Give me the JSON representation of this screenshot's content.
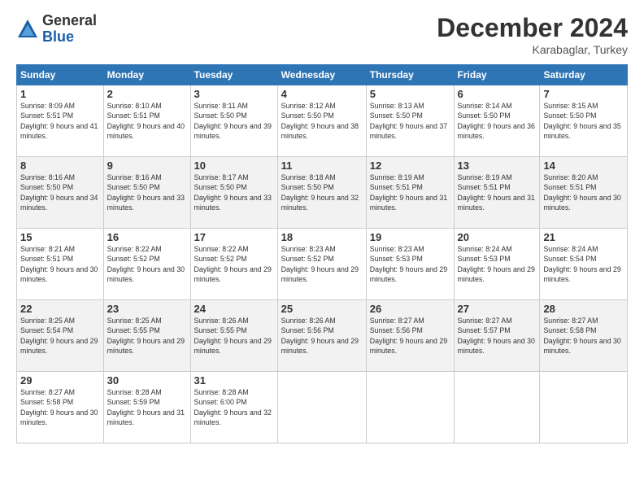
{
  "header": {
    "logo": {
      "general": "General",
      "blue": "Blue"
    },
    "month_title": "December 2024",
    "subtitle": "Karabaglar, Turkey"
  },
  "calendar": {
    "days_of_week": [
      "Sunday",
      "Monday",
      "Tuesday",
      "Wednesday",
      "Thursday",
      "Friday",
      "Saturday"
    ],
    "weeks": [
      [
        null,
        null,
        null,
        null,
        null,
        null,
        null
      ]
    ],
    "cells": [
      {
        "day": 1,
        "col": 0,
        "sunrise": "8:09 AM",
        "sunset": "5:51 PM",
        "daylight": "9 hours and 41 minutes."
      },
      {
        "day": 2,
        "col": 1,
        "sunrise": "8:10 AM",
        "sunset": "5:51 PM",
        "daylight": "9 hours and 40 minutes."
      },
      {
        "day": 3,
        "col": 2,
        "sunrise": "8:11 AM",
        "sunset": "5:50 PM",
        "daylight": "9 hours and 39 minutes."
      },
      {
        "day": 4,
        "col": 3,
        "sunrise": "8:12 AM",
        "sunset": "5:50 PM",
        "daylight": "9 hours and 38 minutes."
      },
      {
        "day": 5,
        "col": 4,
        "sunrise": "8:13 AM",
        "sunset": "5:50 PM",
        "daylight": "9 hours and 37 minutes."
      },
      {
        "day": 6,
        "col": 5,
        "sunrise": "8:14 AM",
        "sunset": "5:50 PM",
        "daylight": "9 hours and 36 minutes."
      },
      {
        "day": 7,
        "col": 6,
        "sunrise": "8:15 AM",
        "sunset": "5:50 PM",
        "daylight": "9 hours and 35 minutes."
      },
      {
        "day": 8,
        "col": 0,
        "sunrise": "8:16 AM",
        "sunset": "5:50 PM",
        "daylight": "9 hours and 34 minutes."
      },
      {
        "day": 9,
        "col": 1,
        "sunrise": "8:16 AM",
        "sunset": "5:50 PM",
        "daylight": "9 hours and 33 minutes."
      },
      {
        "day": 10,
        "col": 2,
        "sunrise": "8:17 AM",
        "sunset": "5:50 PM",
        "daylight": "9 hours and 33 minutes."
      },
      {
        "day": 11,
        "col": 3,
        "sunrise": "8:18 AM",
        "sunset": "5:50 PM",
        "daylight": "9 hours and 32 minutes."
      },
      {
        "day": 12,
        "col": 4,
        "sunrise": "8:19 AM",
        "sunset": "5:51 PM",
        "daylight": "9 hours and 31 minutes."
      },
      {
        "day": 13,
        "col": 5,
        "sunrise": "8:19 AM",
        "sunset": "5:51 PM",
        "daylight": "9 hours and 31 minutes."
      },
      {
        "day": 14,
        "col": 6,
        "sunrise": "8:20 AM",
        "sunset": "5:51 PM",
        "daylight": "9 hours and 30 minutes."
      },
      {
        "day": 15,
        "col": 0,
        "sunrise": "8:21 AM",
        "sunset": "5:51 PM",
        "daylight": "9 hours and 30 minutes."
      },
      {
        "day": 16,
        "col": 1,
        "sunrise": "8:22 AM",
        "sunset": "5:52 PM",
        "daylight": "9 hours and 30 minutes."
      },
      {
        "day": 17,
        "col": 2,
        "sunrise": "8:22 AM",
        "sunset": "5:52 PM",
        "daylight": "9 hours and 29 minutes."
      },
      {
        "day": 18,
        "col": 3,
        "sunrise": "8:23 AM",
        "sunset": "5:52 PM",
        "daylight": "9 hours and 29 minutes."
      },
      {
        "day": 19,
        "col": 4,
        "sunrise": "8:23 AM",
        "sunset": "5:53 PM",
        "daylight": "9 hours and 29 minutes."
      },
      {
        "day": 20,
        "col": 5,
        "sunrise": "8:24 AM",
        "sunset": "5:53 PM",
        "daylight": "9 hours and 29 minutes."
      },
      {
        "day": 21,
        "col": 6,
        "sunrise": "8:24 AM",
        "sunset": "5:54 PM",
        "daylight": "9 hours and 29 minutes."
      },
      {
        "day": 22,
        "col": 0,
        "sunrise": "8:25 AM",
        "sunset": "5:54 PM",
        "daylight": "9 hours and 29 minutes."
      },
      {
        "day": 23,
        "col": 1,
        "sunrise": "8:25 AM",
        "sunset": "5:55 PM",
        "daylight": "9 hours and 29 minutes."
      },
      {
        "day": 24,
        "col": 2,
        "sunrise": "8:26 AM",
        "sunset": "5:55 PM",
        "daylight": "9 hours and 29 minutes."
      },
      {
        "day": 25,
        "col": 3,
        "sunrise": "8:26 AM",
        "sunset": "5:56 PM",
        "daylight": "9 hours and 29 minutes."
      },
      {
        "day": 26,
        "col": 4,
        "sunrise": "8:27 AM",
        "sunset": "5:56 PM",
        "daylight": "9 hours and 29 minutes."
      },
      {
        "day": 27,
        "col": 5,
        "sunrise": "8:27 AM",
        "sunset": "5:57 PM",
        "daylight": "9 hours and 30 minutes."
      },
      {
        "day": 28,
        "col": 6,
        "sunrise": "8:27 AM",
        "sunset": "5:58 PM",
        "daylight": "9 hours and 30 minutes."
      },
      {
        "day": 29,
        "col": 0,
        "sunrise": "8:27 AM",
        "sunset": "5:58 PM",
        "daylight": "9 hours and 30 minutes."
      },
      {
        "day": 30,
        "col": 1,
        "sunrise": "8:28 AM",
        "sunset": "5:59 PM",
        "daylight": "9 hours and 31 minutes."
      },
      {
        "day": 31,
        "col": 2,
        "sunrise": "8:28 AM",
        "sunset": "6:00 PM",
        "daylight": "9 hours and 32 minutes."
      }
    ]
  }
}
